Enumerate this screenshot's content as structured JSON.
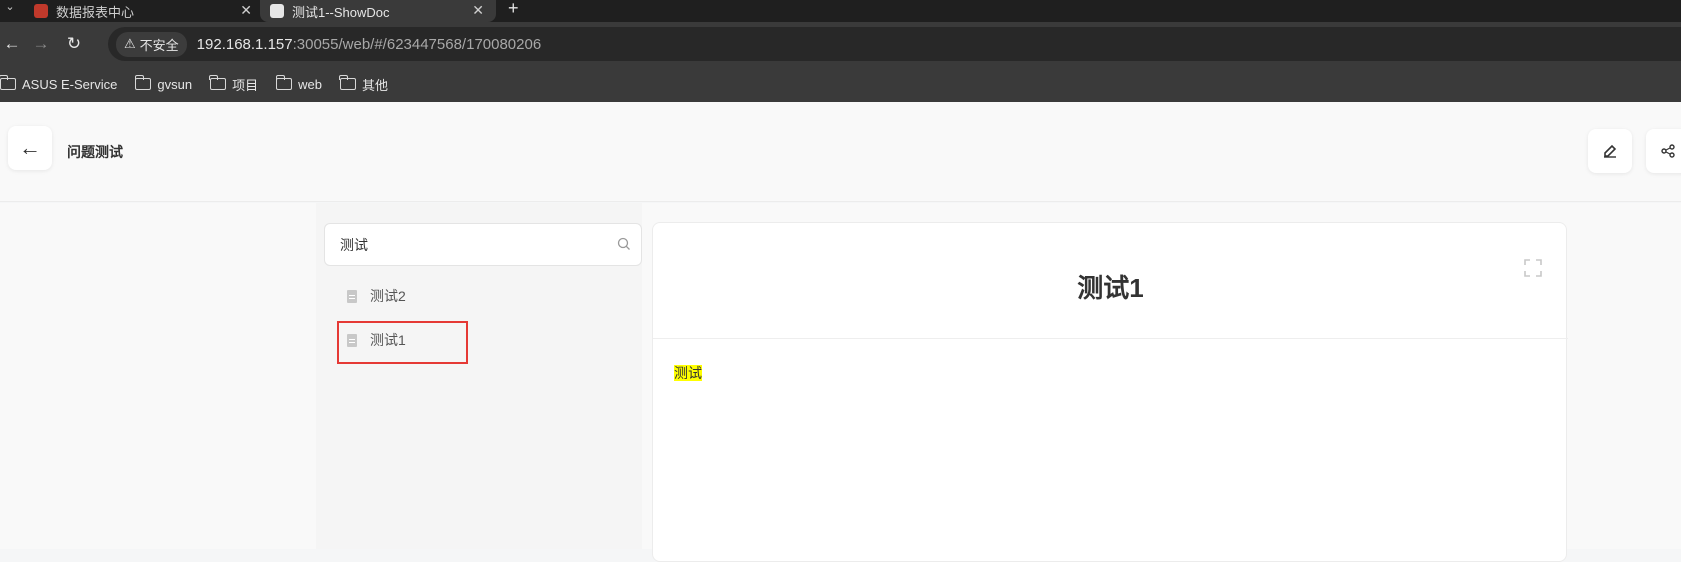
{
  "browser": {
    "tabs": [
      {
        "title": "数据报表中心",
        "active": false
      },
      {
        "title": "测试1--ShowDoc",
        "active": true
      }
    ],
    "security_label": "不安全",
    "url_host": "192.168.1.157",
    "url_rest": ":30055/web/#/623447568/170080206",
    "bookmarks": [
      "ASUS E-Service",
      "gvsun",
      "项目",
      "web",
      "其他"
    ]
  },
  "header": {
    "project_title": "问题测试"
  },
  "sidebar": {
    "search_value": "测试",
    "items": [
      {
        "label": "测试2"
      },
      {
        "label": "测试1",
        "selected": true
      }
    ]
  },
  "document": {
    "title": "测试1",
    "body_highlight": "测试"
  },
  "colors": {
    "highlight_border": "#e53935",
    "text_highlight": "#ffff00"
  }
}
